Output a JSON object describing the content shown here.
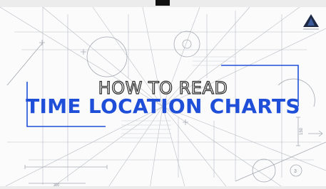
{
  "title": {
    "line1": "HOW TO READ",
    "line2": "TIME LOCATION CHARTS"
  },
  "drawing_annotations": {
    "dimension_right": "150",
    "circle_number": "3",
    "dimension_bottom": "300"
  },
  "logo": {
    "icon": "brand-triangle-icon"
  },
  "colors": {
    "accent": "#1f4fd8",
    "outline_text": "#2a2a2a",
    "sketch_lines": "#9a9fa8",
    "background": "#fbfbfc"
  }
}
